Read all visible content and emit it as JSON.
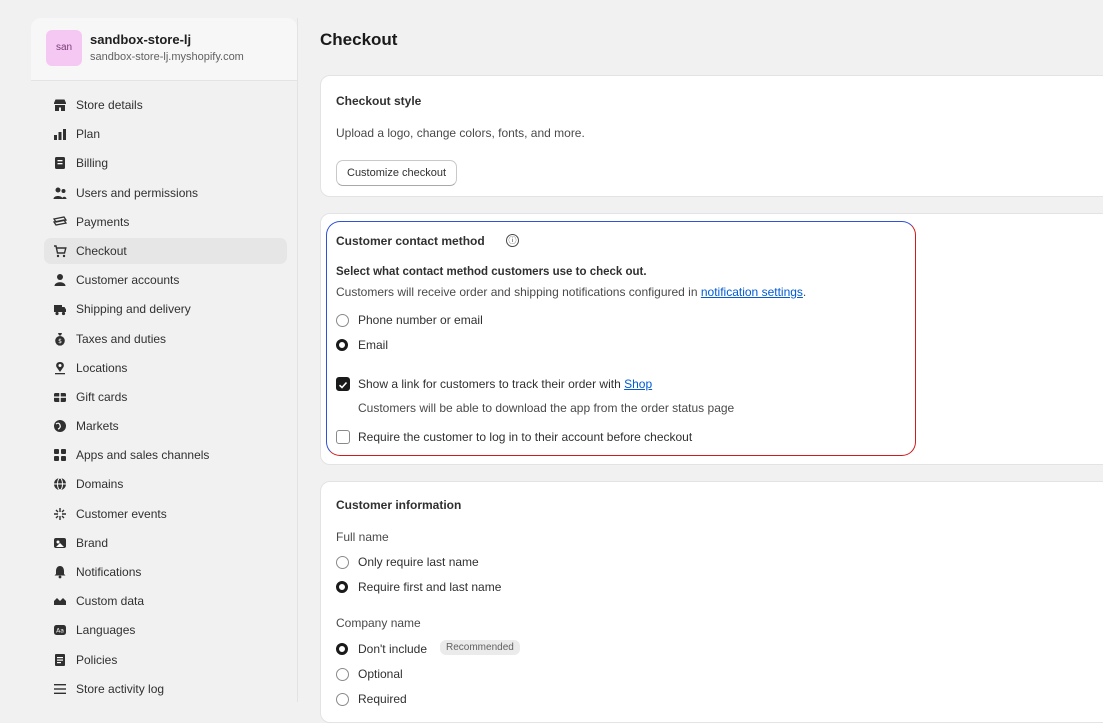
{
  "store": {
    "avatar_text": "san",
    "name": "sandbox-store-lj",
    "url": "sandbox-store-lj.myshopify.com"
  },
  "sidebar": {
    "items": [
      {
        "label": "Store details",
        "icon": "store-icon"
      },
      {
        "label": "Plan",
        "icon": "plan-icon"
      },
      {
        "label": "Billing",
        "icon": "billing-icon"
      },
      {
        "label": "Users and permissions",
        "icon": "users-icon"
      },
      {
        "label": "Payments",
        "icon": "payments-icon"
      },
      {
        "label": "Checkout",
        "icon": "cart-icon",
        "active": true
      },
      {
        "label": "Customer accounts",
        "icon": "person-icon"
      },
      {
        "label": "Shipping and delivery",
        "icon": "truck-icon"
      },
      {
        "label": "Taxes and duties",
        "icon": "money-bag-icon"
      },
      {
        "label": "Locations",
        "icon": "location-pin-icon"
      },
      {
        "label": "Gift cards",
        "icon": "gift-card-icon"
      },
      {
        "label": "Markets",
        "icon": "globe-icon"
      },
      {
        "label": "Apps and sales channels",
        "icon": "apps-icon"
      },
      {
        "label": "Domains",
        "icon": "domain-globe-icon"
      },
      {
        "label": "Customer events",
        "icon": "sparkle-icon"
      },
      {
        "label": "Brand",
        "icon": "brand-icon"
      },
      {
        "label": "Notifications",
        "icon": "bell-icon"
      },
      {
        "label": "Custom data",
        "icon": "custom-data-icon"
      },
      {
        "label": "Languages",
        "icon": "language-icon"
      },
      {
        "label": "Policies",
        "icon": "policy-icon"
      },
      {
        "label": "Store activity log",
        "icon": "list-icon"
      }
    ]
  },
  "page": {
    "title": "Checkout"
  },
  "checkout_style": {
    "title": "Checkout style",
    "description": "Upload a logo, change colors, fonts, and more.",
    "button_label": "Customize checkout"
  },
  "contact_method": {
    "title": "Customer contact method",
    "info_icon": "ⓘ",
    "subtitle": "Select what contact method customers use to check out.",
    "help_prefix": "Customers will receive order and shipping notifications configured in ",
    "help_link": "notification settings",
    "help_suffix": ".",
    "options": [
      {
        "label": "Phone number or email",
        "selected": false
      },
      {
        "label": "Email",
        "selected": true
      }
    ],
    "track_prefix": "Show a link for customers to track their order with ",
    "track_link": "Shop",
    "track_checked": true,
    "track_help": "Customers will be able to download the app from the order status page",
    "require_login_label": "Require the customer to log in to their account before checkout",
    "require_login_checked": false
  },
  "customer_info": {
    "title": "Customer information",
    "full_name_label": "Full name",
    "full_name_options": [
      {
        "label": "Only require last name",
        "selected": false
      },
      {
        "label": "Require first and last name",
        "selected": true
      }
    ],
    "company_label": "Company name",
    "company_options": [
      {
        "label": "Don't include",
        "selected": true,
        "badge": "Recommended"
      },
      {
        "label": "Optional",
        "selected": false
      },
      {
        "label": "Required",
        "selected": false
      }
    ]
  },
  "colors": {
    "accent_link": "#005bd3",
    "highlight_blue": "#2f52d6",
    "highlight_red": "#cf1b1b",
    "avatar_bg": "#f5c8f3"
  }
}
